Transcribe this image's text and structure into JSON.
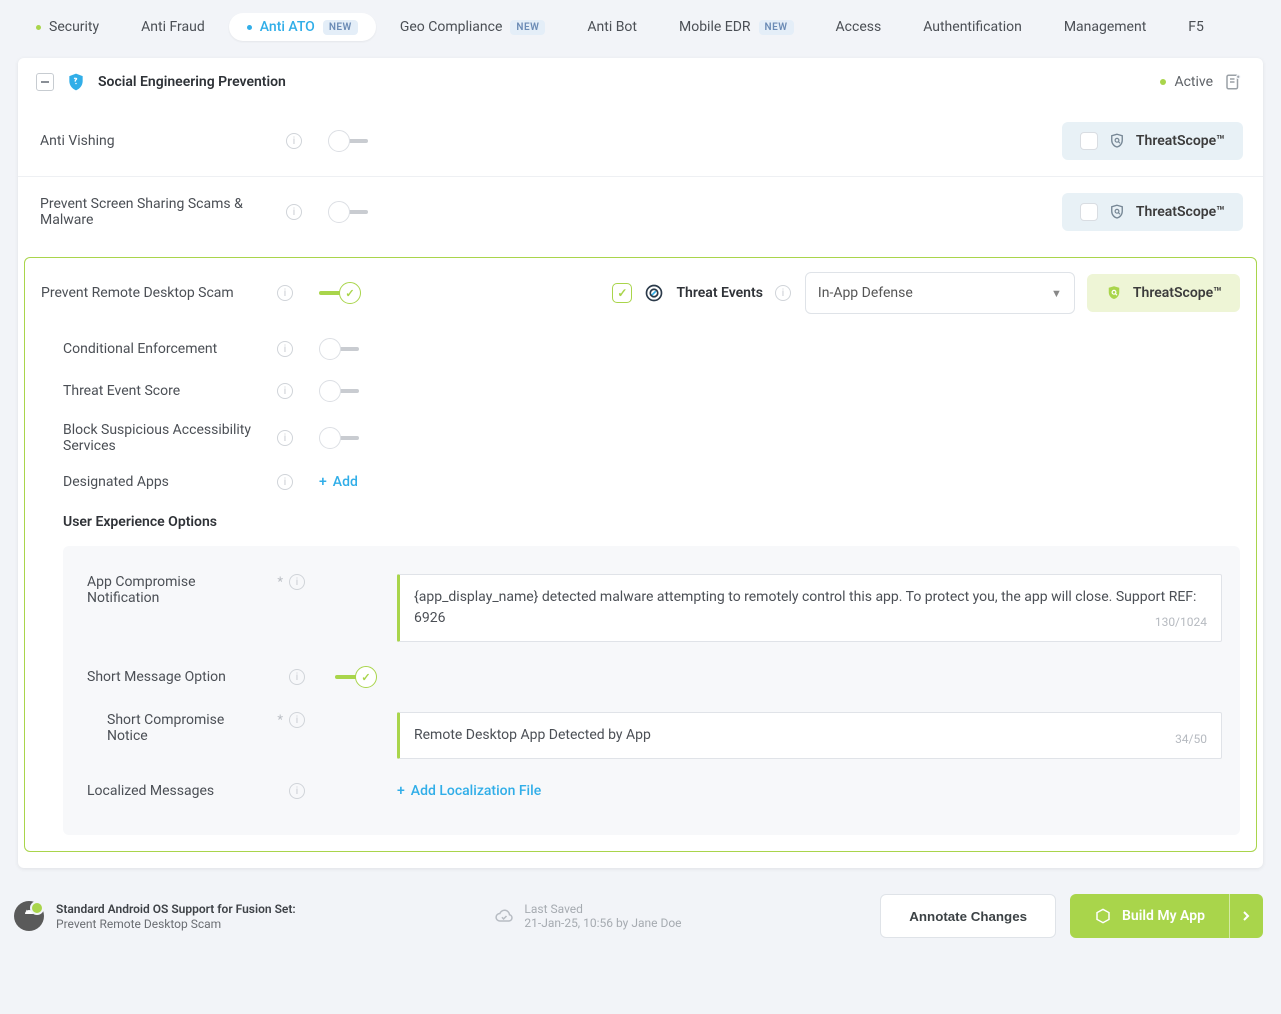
{
  "tabs": [
    {
      "label": "Security",
      "dot": true
    },
    {
      "label": "Anti Fraud"
    },
    {
      "label": "Anti ATO",
      "dot": true,
      "new": "NEW",
      "active": true
    },
    {
      "label": "Geo Compliance",
      "new": "NEW"
    },
    {
      "label": "Anti Bot"
    },
    {
      "label": "Mobile EDR",
      "new": "NEW"
    },
    {
      "label": "Access"
    },
    {
      "label": "Authentification"
    },
    {
      "label": "Management"
    },
    {
      "label": "F5"
    }
  ],
  "card": {
    "title": "Social Engineering Prevention",
    "status": "Active"
  },
  "rows": {
    "anti_vishing": "Anti Vishing",
    "prevent_screen_sharing": "Prevent Screen Sharing Scams & Malware"
  },
  "threatscope": "ThreatScope™",
  "highlight": {
    "title": "Prevent Remote Desktop Scam",
    "threat_events": "Threat Events",
    "dropdown": "In-App Defense",
    "sub": {
      "conditional": "Conditional Enforcement",
      "score": "Threat Event Score",
      "block_access": "Block Suspicious Accessibility Services",
      "designated": "Designated Apps",
      "add": "Add"
    },
    "uxo_header": "User Experience Options",
    "uxo": {
      "app_comp": "App Compromise Notification",
      "app_comp_text": "{app_display_name} detected malware attempting to remotely control this app. To protect you, the app will close. Support REF: 6926",
      "app_comp_counter": "130/1024",
      "short_msg": "Short Message Option",
      "short_notice": "Short Compromise Notice",
      "short_notice_text": "Remote Desktop App Detected by App",
      "short_notice_counter": "34/50",
      "localized": "Localized Messages",
      "add_file": "Add Localization File"
    }
  },
  "footer": {
    "os_label": "Standard Android OS Support for Fusion Set:",
    "os_value": "Prevent Remote Desktop Scam",
    "saved_label": "Last Saved",
    "saved_value": "21-Jan-25, 10:56 by Jane Doe",
    "annotate": "Annotate Changes",
    "build": "Build My App"
  }
}
